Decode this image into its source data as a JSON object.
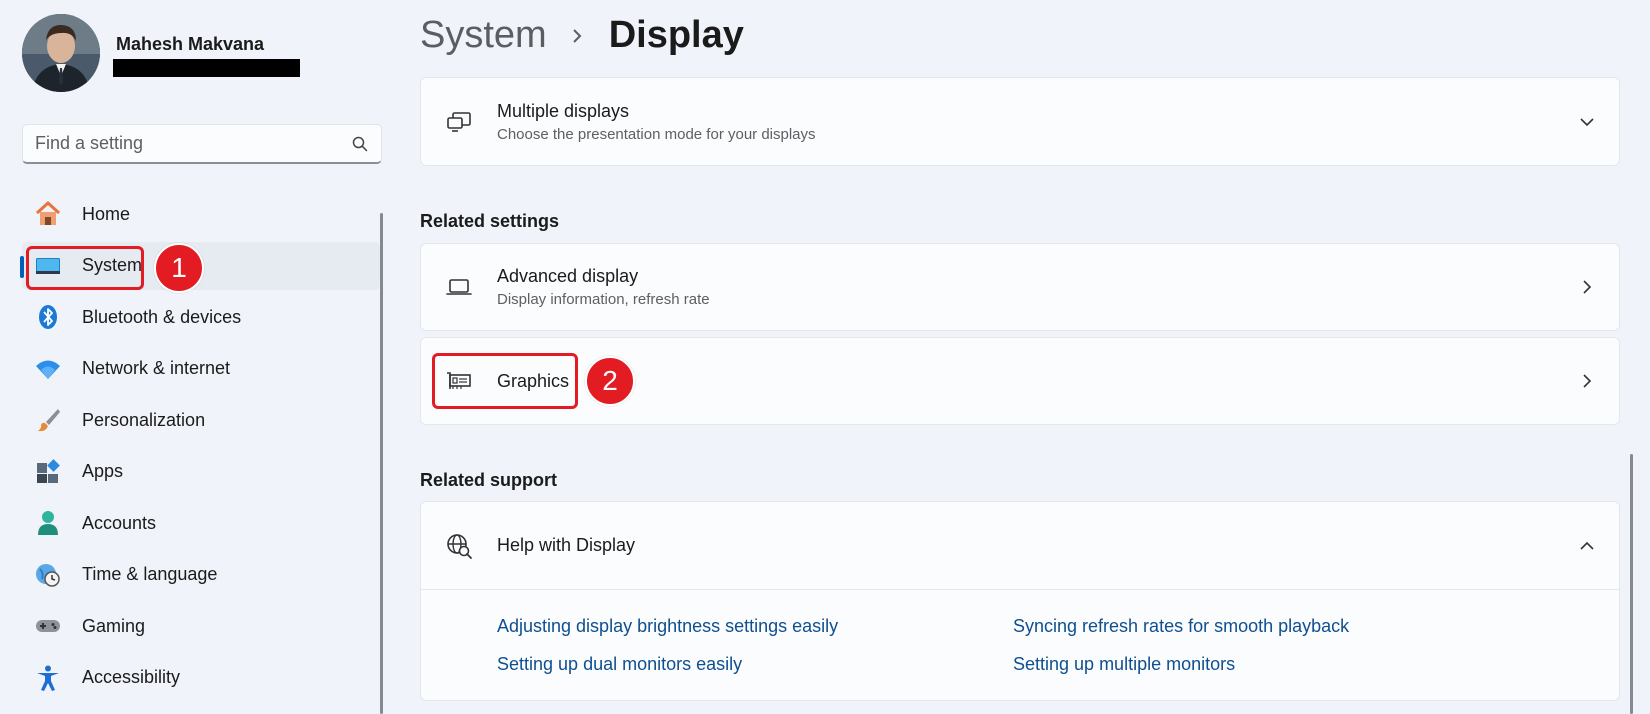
{
  "user": {
    "name": "Mahesh Makvana"
  },
  "search": {
    "placeholder": "Find a setting"
  },
  "sidebar": {
    "items": [
      {
        "label": "Home",
        "icon": "home-icon"
      },
      {
        "label": "System",
        "icon": "monitor-icon",
        "selected": true
      },
      {
        "label": "Bluetooth & devices",
        "icon": "bluetooth-icon"
      },
      {
        "label": "Network & internet",
        "icon": "wifi-icon"
      },
      {
        "label": "Personalization",
        "icon": "brush-icon"
      },
      {
        "label": "Apps",
        "icon": "apps-icon"
      },
      {
        "label": "Accounts",
        "icon": "person-icon"
      },
      {
        "label": "Time & language",
        "icon": "clock-globe-icon"
      },
      {
        "label": "Gaming",
        "icon": "gamepad-icon"
      },
      {
        "label": "Accessibility",
        "icon": "accessibility-icon"
      }
    ]
  },
  "breadcrumb": {
    "parent": "System",
    "current": "Display"
  },
  "main": {
    "multiple_displays": {
      "title": "Multiple displays",
      "subtitle": "Choose the presentation mode for your displays"
    },
    "related_settings_title": "Related settings",
    "advanced_display": {
      "title": "Advanced display",
      "subtitle": "Display information, refresh rate"
    },
    "graphics": {
      "title": "Graphics"
    },
    "related_support_title": "Related support",
    "help": {
      "title": "Help with Display",
      "links": [
        "Adjusting display brightness settings easily",
        "Syncing refresh rates for smooth playback",
        "Setting up dual monitors easily",
        "Setting up multiple monitors"
      ]
    }
  },
  "callouts": {
    "one": "1",
    "two": "2"
  },
  "colors": {
    "accent": "#005fb8",
    "callout": "#e31c23",
    "link": "#0f4f8f"
  }
}
